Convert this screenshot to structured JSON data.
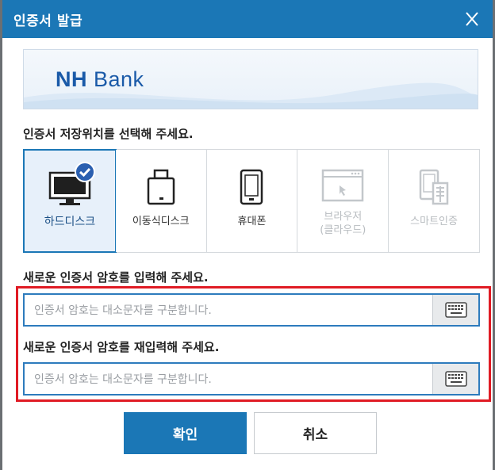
{
  "dialog": {
    "title": "인증서 발급",
    "close_label": "X"
  },
  "banner": {
    "logo_nh": "NH",
    "logo_bank": "Bank"
  },
  "storage": {
    "heading": "인증서 저장위치를 선택해 주세요.",
    "options": [
      {
        "label": "하드디스크",
        "icon": "monitor-icon",
        "state": "selected"
      },
      {
        "label": "이동식디스크",
        "icon": "usb-drive-icon",
        "state": "enabled"
      },
      {
        "label": "휴대폰",
        "icon": "phone-icon",
        "state": "enabled"
      },
      {
        "label": "브라우저\n(클라우드)",
        "icon": "browser-cloud-icon",
        "state": "disabled"
      },
      {
        "label": "스마트인증",
        "icon": "smart-cert-icon",
        "state": "disabled"
      }
    ]
  },
  "password": {
    "heading": "새로운 인증서 암호를 입력해 주세요.",
    "placeholder": "인증서 암호는 대소문자를 구분합니다.",
    "value": ""
  },
  "password_confirm": {
    "heading": "새로운 인증서 암호를 재입력해 주세요.",
    "placeholder": "인증서 암호는 대소문자를 구분합니다.",
    "value": ""
  },
  "buttons": {
    "ok": "확인",
    "cancel": "취소"
  },
  "colors": {
    "accent": "#1b77b6",
    "highlight_border": "#e01b24"
  }
}
